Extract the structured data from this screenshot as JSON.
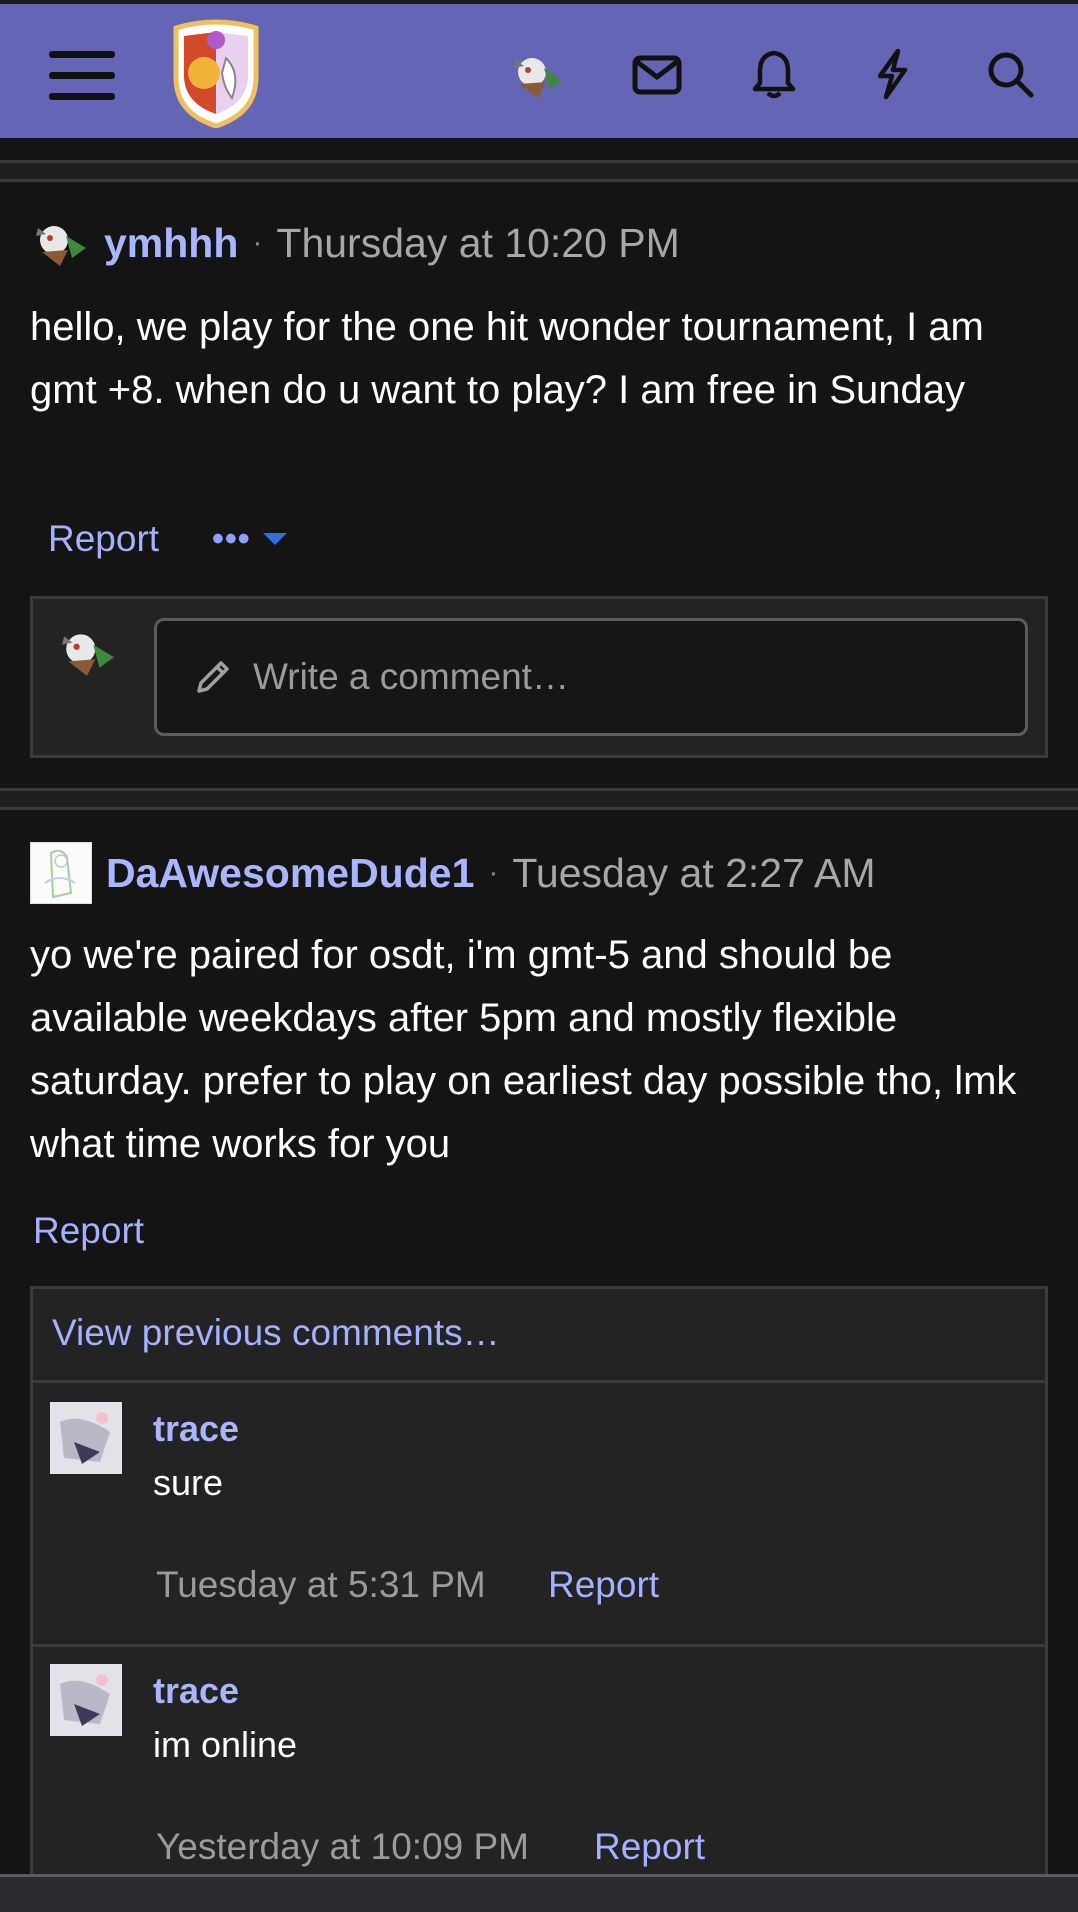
{
  "topbar": {
    "background": "#6466b5",
    "icons": [
      "menu-icon",
      "site-logo",
      "user-avatar",
      "mail-icon",
      "bell-icon",
      "bolt-icon",
      "search-icon"
    ]
  },
  "posts": [
    {
      "username": "ymhhh",
      "time": "Thursday at 10:20 PM",
      "body": "hello, we play for the one hit wonder tournament, I am gmt +8. when do u want to play? I am free in Sunday",
      "report": "Report",
      "more": "•••",
      "comment_placeholder": "Write a comment…"
    },
    {
      "username": "DaAwesomeDude1",
      "time": "Tuesday at 2:27 AM",
      "body": "yo we're paired for osdt, i'm gmt-5 and should be available weekdays after 5pm and mostly flexible saturday. prefer to play on earliest day possible tho, lmk what time works for you",
      "report": "Report",
      "view_previous": "View previous comments…",
      "comments": [
        {
          "username": "trace",
          "text": "sure",
          "time": "Tuesday at 5:31 PM",
          "report": "Report"
        },
        {
          "username": "trace",
          "text": "im online",
          "time": "Yesterday at 10:09 PM",
          "report": "Report"
        }
      ]
    }
  ],
  "colors": {
    "accent_link": "#a9b6ff",
    "page_bg": "#141414"
  }
}
